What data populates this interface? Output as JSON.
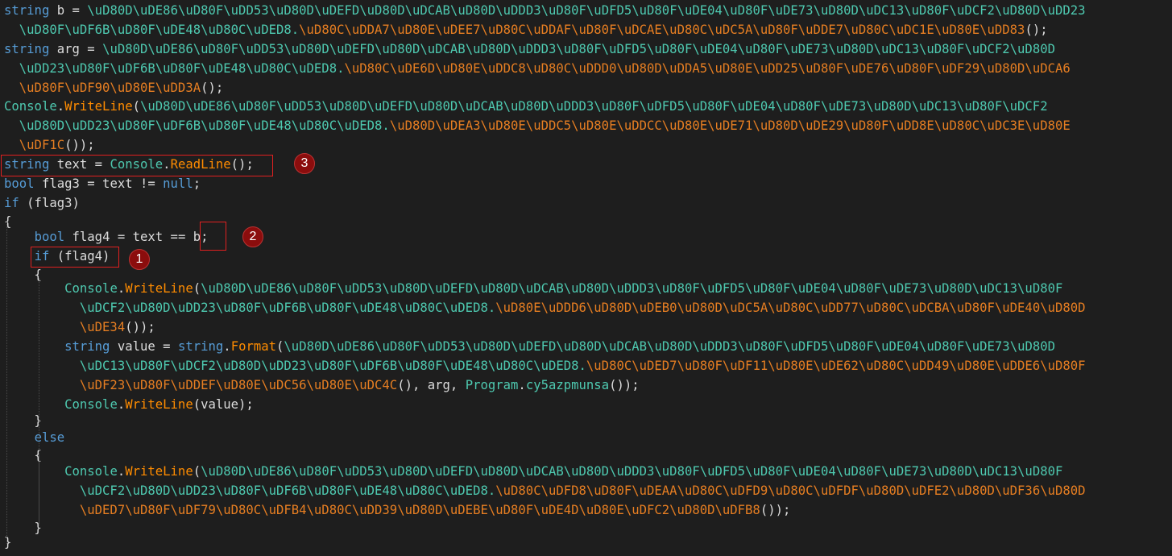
{
  "lines": [
    [
      [
        "kw",
        "string"
      ],
      [
        "id",
        " b = "
      ],
      [
        "ns",
        "\\uD80D\\uDE86\\uD80F\\uDD53\\uD80D\\uDEFD\\uD80D\\uDCAB\\uD80D\\uDDD3\\uD80F\\uDFD5\\uD80F\\uDE04\\uD80F\\uDE73\\uD80D\\uDC13\\uD80F\\uDCF2\\uD80D\\uDD23"
      ]
    ],
    [
      [
        "ns",
        "  \\uD80F\\uDF6B\\uD80F\\uDE48\\uD80C\\uDED8."
      ],
      [
        "es",
        "\\uD80C\\uDDA7\\uD80E\\uDEE7\\uD80C\\uDDAF\\uD80F\\uDCAE\\uD80C\\uDC5A\\uD80F\\uDDE7\\uD80C\\uDC1E\\uD80E\\uDD83"
      ],
      [
        "id",
        "();"
      ]
    ],
    [
      [
        "kw",
        "string"
      ],
      [
        "id",
        " arg = "
      ],
      [
        "ns",
        "\\uD80D\\uDE86\\uD80F\\uDD53\\uD80D\\uDEFD\\uD80D\\uDCAB\\uD80D\\uDDD3\\uD80F\\uDFD5\\uD80F\\uDE04\\uD80F\\uDE73\\uD80D\\uDC13\\uD80F\\uDCF2\\uD80D"
      ]
    ],
    [
      [
        "ns",
        "  \\uDD23\\uD80F\\uDF6B\\uD80F\\uDE48\\uD80C\\uDED8."
      ],
      [
        "es",
        "\\uD80C\\uDE6D\\uD80E\\uDDC8\\uD80C\\uDDD0\\uD80D\\uDDA5\\uD80E\\uDD25\\uD80F\\uDE76\\uD80F\\uDF29\\uD80D\\uDCA6"
      ]
    ],
    [
      [
        "es",
        "  \\uD80F\\uDF90\\uD80E\\uDD3A"
      ],
      [
        "id",
        "();"
      ]
    ],
    [
      [
        "ty",
        "Console"
      ],
      [
        "id",
        "."
      ],
      [
        "me",
        "WriteLine"
      ],
      [
        "id",
        "("
      ],
      [
        "ns",
        "\\uD80D\\uDE86\\uD80F\\uDD53\\uD80D\\uDEFD\\uD80D\\uDCAB\\uD80D\\uDDD3\\uD80F\\uDFD5\\uD80F\\uDE04\\uD80F\\uDE73\\uD80D\\uDC13\\uD80F\\uDCF2"
      ]
    ],
    [
      [
        "ns",
        "  \\uD80D\\uDD23\\uD80F\\uDF6B\\uD80F\\uDE48\\uD80C\\uDED8."
      ],
      [
        "es",
        "\\uD80D\\uDEA3\\uD80E\\uDDC5\\uD80E\\uDDCC\\uD80E\\uDE71\\uD80D\\uDE29\\uD80F\\uDD8E\\uD80C\\uDC3E\\uD80E"
      ]
    ],
    [
      [
        "es",
        "  \\uDF1C"
      ],
      [
        "id",
        "());"
      ]
    ],
    [
      [
        "kw",
        "string"
      ],
      [
        "id",
        " text = "
      ],
      [
        "ty",
        "Console"
      ],
      [
        "id",
        "."
      ],
      [
        "me",
        "ReadLine"
      ],
      [
        "id",
        "();"
      ]
    ],
    [
      [
        "kw",
        "bool"
      ],
      [
        "id",
        " flag3 = text != "
      ],
      [
        "kw",
        "null"
      ],
      [
        "id",
        ";"
      ]
    ],
    [
      [
        "kw",
        "if"
      ],
      [
        "id",
        " (flag3)"
      ]
    ],
    [
      [
        "id",
        "{"
      ]
    ],
    [
      [
        "id",
        "    "
      ],
      [
        "kw",
        "bool"
      ],
      [
        "id",
        " flag4 = text == b;"
      ]
    ],
    [
      [
        "id",
        "    "
      ],
      [
        "kw",
        "if"
      ],
      [
        "id",
        " (flag4)"
      ]
    ],
    [
      [
        "id",
        "    {"
      ]
    ],
    [
      [
        "id",
        "        "
      ],
      [
        "ty",
        "Console"
      ],
      [
        "id",
        "."
      ],
      [
        "me",
        "WriteLine"
      ],
      [
        "id",
        "("
      ],
      [
        "ns",
        "\\uD80D\\uDE86\\uD80F\\uDD53\\uD80D\\uDEFD\\uD80D\\uDCAB\\uD80D\\uDDD3\\uD80F\\uDFD5\\uD80F\\uDE04\\uD80F\\uDE73\\uD80D\\uDC13\\uD80F"
      ]
    ],
    [
      [
        "ns",
        "          \\uDCF2\\uD80D\\uDD23\\uD80F\\uDF6B\\uD80F\\uDE48\\uD80C\\uDED8."
      ],
      [
        "es",
        "\\uD80E\\uDDD6\\uD80D\\uDEB0\\uD80D\\uDC5A\\uD80C\\uDD77\\uD80C\\uDCBA\\uD80F\\uDE40\\uD80D"
      ]
    ],
    [
      [
        "es",
        "          \\uDE34"
      ],
      [
        "id",
        "());"
      ]
    ],
    [
      [
        "id",
        "        "
      ],
      [
        "kw",
        "string"
      ],
      [
        "id",
        " value = "
      ],
      [
        "kw",
        "string"
      ],
      [
        "id",
        "."
      ],
      [
        "me",
        "Format"
      ],
      [
        "id",
        "("
      ],
      [
        "ns",
        "\\uD80D\\uDE86\\uD80F\\uDD53\\uD80D\\uDEFD\\uD80D\\uDCAB\\uD80D\\uDDD3\\uD80F\\uDFD5\\uD80F\\uDE04\\uD80F\\uDE73\\uD80D"
      ]
    ],
    [
      [
        "ns",
        "          \\uDC13\\uD80F\\uDCF2\\uD80D\\uDD23\\uD80F\\uDF6B\\uD80F\\uDE48\\uD80C\\uDED8."
      ],
      [
        "es",
        "\\uD80C\\uDED7\\uD80F\\uDF11\\uD80E\\uDE62\\uD80C\\uDD49\\uD80E\\uDDE6\\uD80F"
      ]
    ],
    [
      [
        "es",
        "          \\uDF23\\uD80F\\uDDEF\\uD80E\\uDC56\\uD80E\\uDC4C"
      ],
      [
        "id",
        "(), arg, "
      ],
      [
        "ty",
        "Program"
      ],
      [
        "id",
        "."
      ],
      [
        "ns",
        "cy5azpmunsa"
      ],
      [
        "id",
        "());"
      ]
    ],
    [
      [
        "id",
        "        "
      ],
      [
        "ty",
        "Console"
      ],
      [
        "id",
        "."
      ],
      [
        "me",
        "WriteLine"
      ],
      [
        "id",
        "(value);"
      ]
    ],
    [
      [
        "id",
        "    }"
      ]
    ],
    [
      [
        "id",
        "    "
      ],
      [
        "kw",
        "else"
      ]
    ],
    [
      [
        "id",
        "    {"
      ]
    ],
    [
      [
        "id",
        "        "
      ],
      [
        "ty",
        "Console"
      ],
      [
        "id",
        "."
      ],
      [
        "me",
        "WriteLine"
      ],
      [
        "id",
        "("
      ],
      [
        "ns",
        "\\uD80D\\uDE86\\uD80F\\uDD53\\uD80D\\uDEFD\\uD80D\\uDCAB\\uD80D\\uDDD3\\uD80F\\uDFD5\\uD80F\\uDE04\\uD80F\\uDE73\\uD80D\\uDC13\\uD80F"
      ]
    ],
    [
      [
        "ns",
        "          \\uDCF2\\uD80D\\uDD23\\uD80F\\uDF6B\\uD80F\\uDE48\\uD80C\\uDED8."
      ],
      [
        "es",
        "\\uD80C\\uDFD8\\uD80F\\uDEAA\\uD80C\\uDFD9\\uD80C\\uDFDF\\uD80D\\uDFE2\\uD80D\\uDF36\\uD80D"
      ]
    ],
    [
      [
        "es",
        "          \\uDED7\\uD80F\\uDF79\\uD80C\\uDFB4\\uD80C\\uDD39\\uD80D\\uDEBE\\uD80F\\uDE4D\\uD80E\\uDFC2\\uD80D\\uDFB8"
      ],
      [
        "id",
        "());"
      ]
    ],
    [
      [
        "id",
        "    }"
      ]
    ],
    [
      [
        "id",
        "}"
      ]
    ]
  ],
  "annotations": {
    "badge1": "1",
    "badge2": "2",
    "badge3": "3"
  },
  "colors": {
    "background": "#1e1e1e",
    "keyword": "#569cd6",
    "type": "#4ec9b0",
    "method": "#ff8c00",
    "escape_string": "#e67e22",
    "highlight_box": "#e02020",
    "badge": "#8b0d0d"
  }
}
